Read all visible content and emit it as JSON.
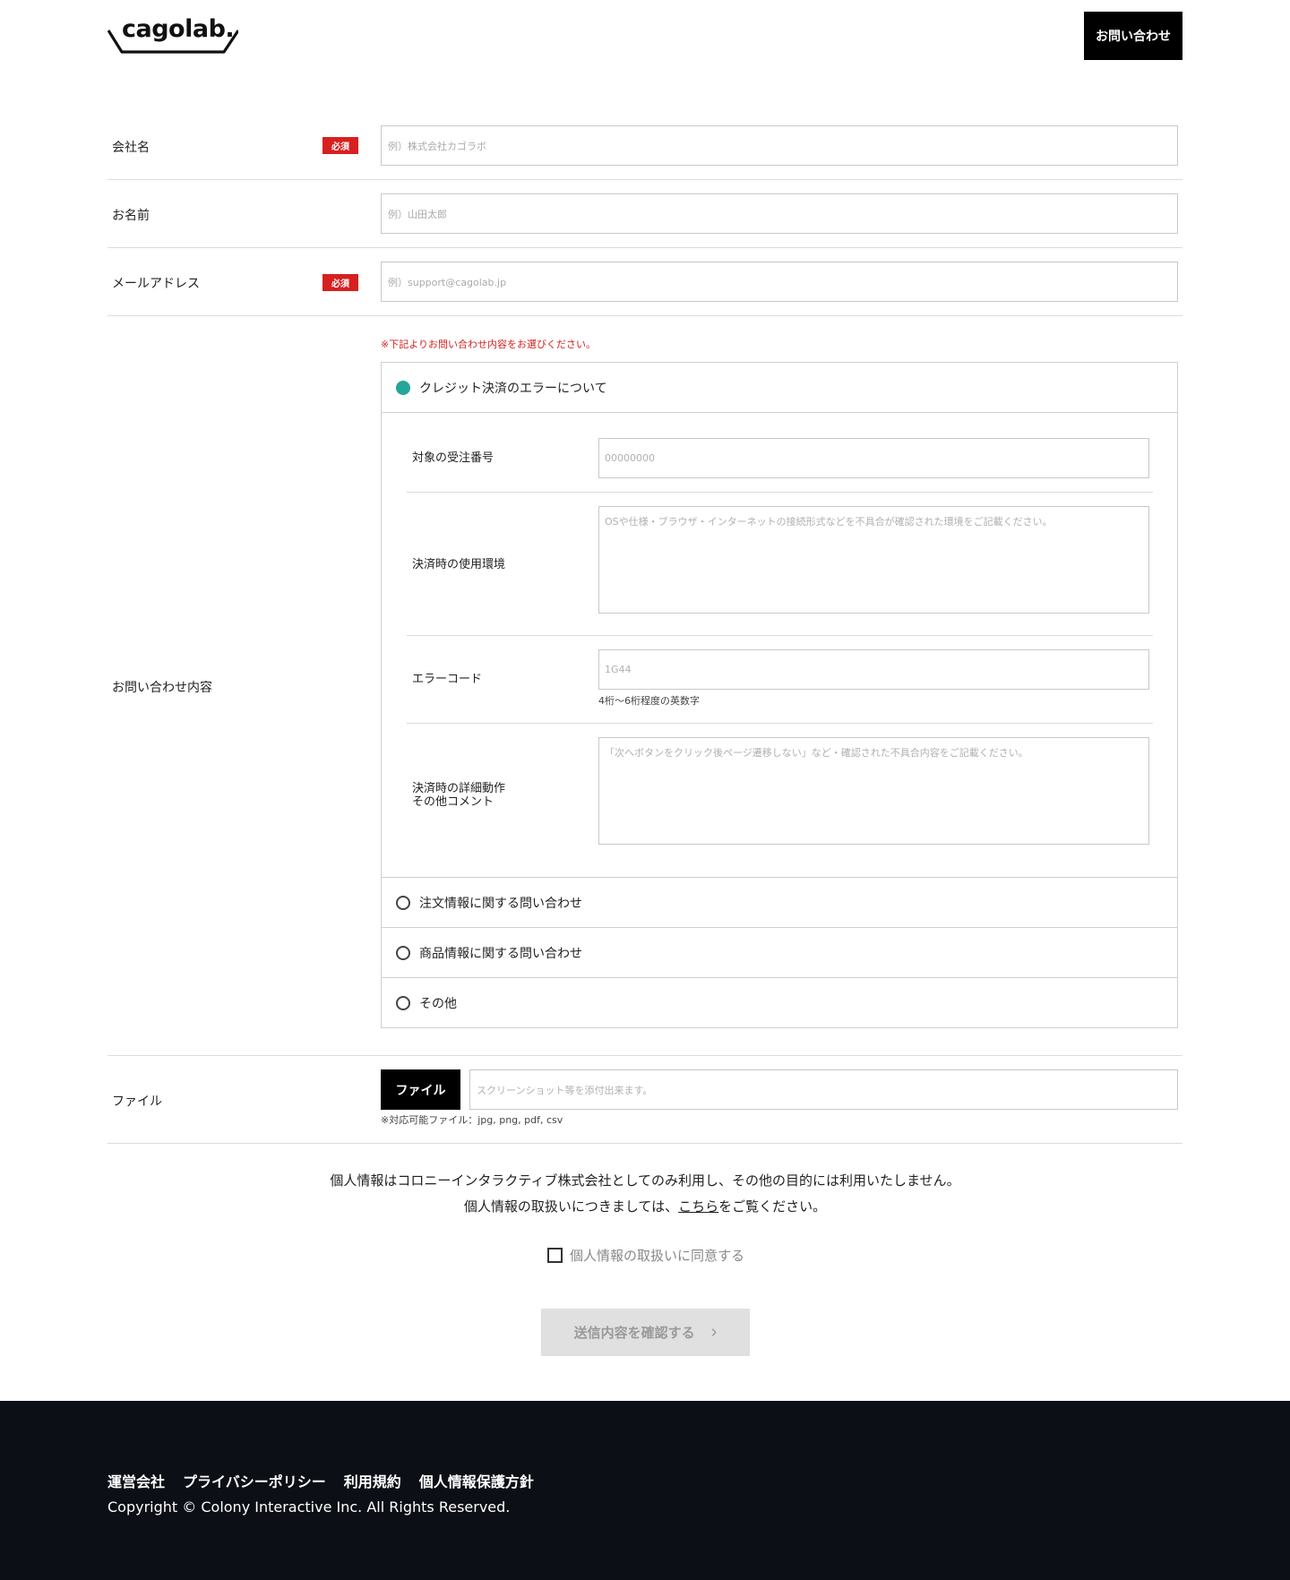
{
  "header": {
    "logo_text": "cagolab.",
    "contact_button": "お問い合わせ"
  },
  "form": {
    "company": {
      "label": "会社名",
      "required": "必須",
      "placeholder": "例）株式会社カゴラボ"
    },
    "name": {
      "label": "お名前",
      "placeholder": "例）山田太郎"
    },
    "email": {
      "label": "メールアドレス",
      "required": "必須",
      "placeholder": "例）support@cagolab.jp"
    },
    "inquiry": {
      "label": "お問い合わせ内容",
      "note": "※下記よりお問い合わせ内容をお選びください。",
      "options": [
        {
          "label": "クレジット決済のエラーについて",
          "selected": true
        },
        {
          "label": "注文情報に関する問い合わせ",
          "selected": false
        },
        {
          "label": "商品情報に関する問い合わせ",
          "selected": false
        },
        {
          "label": "その他",
          "selected": false
        }
      ],
      "sub": {
        "order_number": {
          "label": "対象の受注番号",
          "placeholder": "00000000"
        },
        "environment": {
          "label": "決済時の使用環境",
          "placeholder": "OSや仕様・ブラウザ・インターネットの接続形式などを不具合が確認された環境をご記載ください。"
        },
        "error_code": {
          "label": "エラーコード",
          "placeholder": "1G44",
          "hint": "4桁～6桁程度の英数字"
        },
        "detail": {
          "label_line1": "決済時の詳細動作",
          "label_line2": "その他コメント",
          "placeholder": "「次へボタンをクリック後ページ遷移しない」など・確認された不具合内容をご記載ください。"
        }
      }
    },
    "file": {
      "label": "ファイル",
      "button": "ファイル",
      "placeholder": "スクリーンショット等を添付出来ます。",
      "hint": "※対応可能ファイル：jpg, png, pdf, csv"
    }
  },
  "privacy": {
    "line1": "個人情報はコロニーインタラクティブ株式会社としてのみ利用し、その他の目的には利用いたしません。",
    "line2_pre": "個人情報の取扱いにつきましては、",
    "line2_link": "こちら",
    "line2_post": "をご覧ください。",
    "agree_label": "個人情報の取扱いに同意する"
  },
  "submit": {
    "label": "送信内容を確認する",
    "arrow": "›"
  },
  "footer": {
    "links": [
      "運営会社",
      "プライバシーポリシー",
      "利用規約",
      "個人情報保護方針"
    ],
    "copyright": "Copyright © Colony Interactive Inc. All Rights Reserved."
  },
  "colors": {
    "accent_required": "#d72020",
    "radio_selected": "#26a69a",
    "footer_bg": "#0d0f16"
  }
}
